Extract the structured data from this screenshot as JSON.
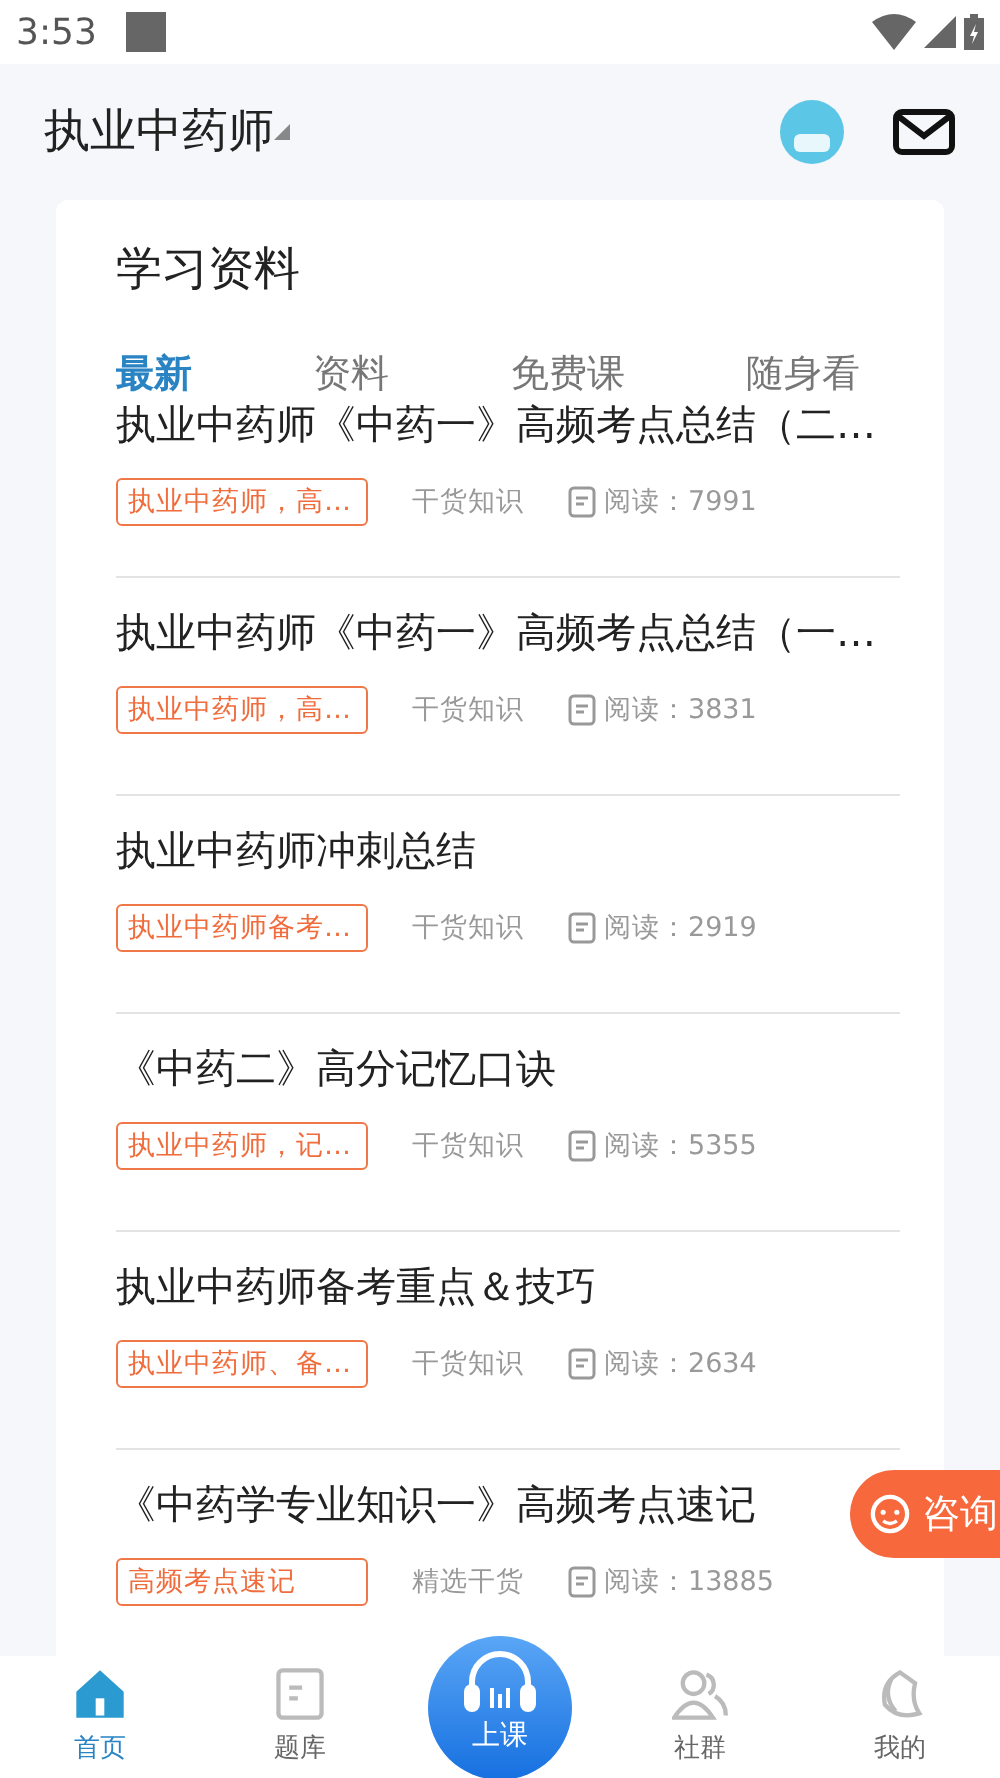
{
  "status_bar": {
    "time": "3:53"
  },
  "header": {
    "title": "执业中药师"
  },
  "section": {
    "title": "学习资料"
  },
  "tabs": [
    {
      "label": "最新",
      "selected": true
    },
    {
      "label": "资料",
      "selected": false
    },
    {
      "label": "免费课",
      "selected": false
    },
    {
      "label": "随身看",
      "selected": false
    }
  ],
  "articles": [
    {
      "title": "执业中药师《中药一》高频考点总结（二…",
      "tag": "执业中药师，高…",
      "category": "干货知识",
      "reads": "阅读：7991"
    },
    {
      "title": "执业中药师《中药一》高频考点总结（一…",
      "tag": "执业中药师，高…",
      "category": "干货知识",
      "reads": "阅读：3831"
    },
    {
      "title": "执业中药师冲刺总结",
      "tag": "执业中药师备考…",
      "category": "干货知识",
      "reads": "阅读：2919"
    },
    {
      "title": "《中药二》高分记忆口诀",
      "tag": "执业中药师，记…",
      "category": "干货知识",
      "reads": "阅读：5355"
    },
    {
      "title": "执业中药师备考重点＆技巧",
      "tag": "执业中药师、备…",
      "category": "干货知识",
      "reads": "阅读：2634"
    },
    {
      "title": "《中药学专业知识一》高频考点速记",
      "tag": "高频考点速记",
      "category": "精选干货",
      "reads": "阅读：13885"
    }
  ],
  "consult_button": {
    "label": "咨询"
  },
  "bottom_nav": [
    {
      "label": "首页",
      "kind": "home",
      "selected": true
    },
    {
      "label": "题库",
      "kind": "bank",
      "selected": false
    },
    {
      "label": "上课",
      "kind": "center",
      "selected": false
    },
    {
      "label": "社群",
      "kind": "group",
      "selected": false
    },
    {
      "label": "我的",
      "kind": "me",
      "selected": false
    }
  ]
}
